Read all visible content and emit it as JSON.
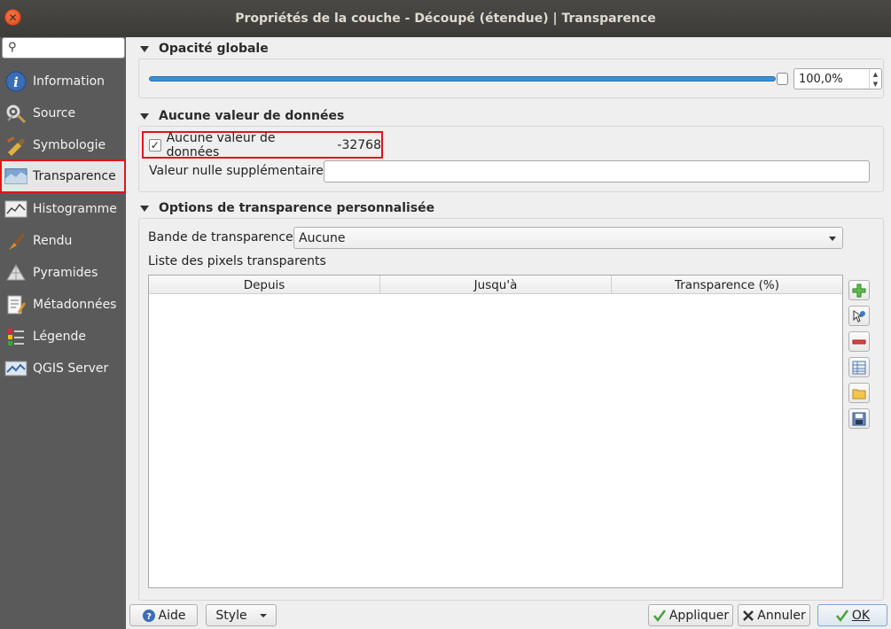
{
  "window": {
    "title": "Propriétés de la couche - Découpé (étendue) | Transparence"
  },
  "sidebar": {
    "search_placeholder": "",
    "items": [
      {
        "label": "Information",
        "icon": "info-icon"
      },
      {
        "label": "Source",
        "icon": "source-icon"
      },
      {
        "label": "Symbologie",
        "icon": "symbology-icon"
      },
      {
        "label": "Transparence",
        "icon": "transparency-icon",
        "active": true
      },
      {
        "label": "Histogramme",
        "icon": "histogram-icon"
      },
      {
        "label": "Rendu",
        "icon": "render-brush-icon"
      },
      {
        "label": "Pyramides",
        "icon": "pyramids-icon"
      },
      {
        "label": "Métadonnées",
        "icon": "metadata-icon"
      },
      {
        "label": "Légende",
        "icon": "legend-icon"
      },
      {
        "label": "QGIS Server",
        "icon": "qgis-server-icon"
      }
    ]
  },
  "global_opacity": {
    "title": "Opacité globale",
    "value_text": "100,0%",
    "value": 1.0
  },
  "no_data": {
    "title": "Aucune valeur de données",
    "checkbox_label": "Aucune valeur de données",
    "checked": true,
    "value": "-32768",
    "extra_label": "Valeur nulle supplémentaire",
    "extra_value": ""
  },
  "custom_transparency": {
    "title": "Options de transparence personnalisée",
    "band_label": "Bande de transparence",
    "band_value": "Aucune",
    "list_label": "Liste des pixels transparents",
    "columns": [
      "Depuis",
      "Jusqu'à",
      "Transparence (%)"
    ],
    "rows": []
  },
  "buttons": {
    "help": "Aide",
    "style": "Style",
    "apply": "Appliquer",
    "cancel": "Annuler",
    "ok": "OK"
  },
  "colors": {
    "accent": "#3d8fd4",
    "highlight_border": "#e0141b",
    "sidebar_bg": "#5a5a5a",
    "titlebar_bg": "#3c3b37"
  }
}
